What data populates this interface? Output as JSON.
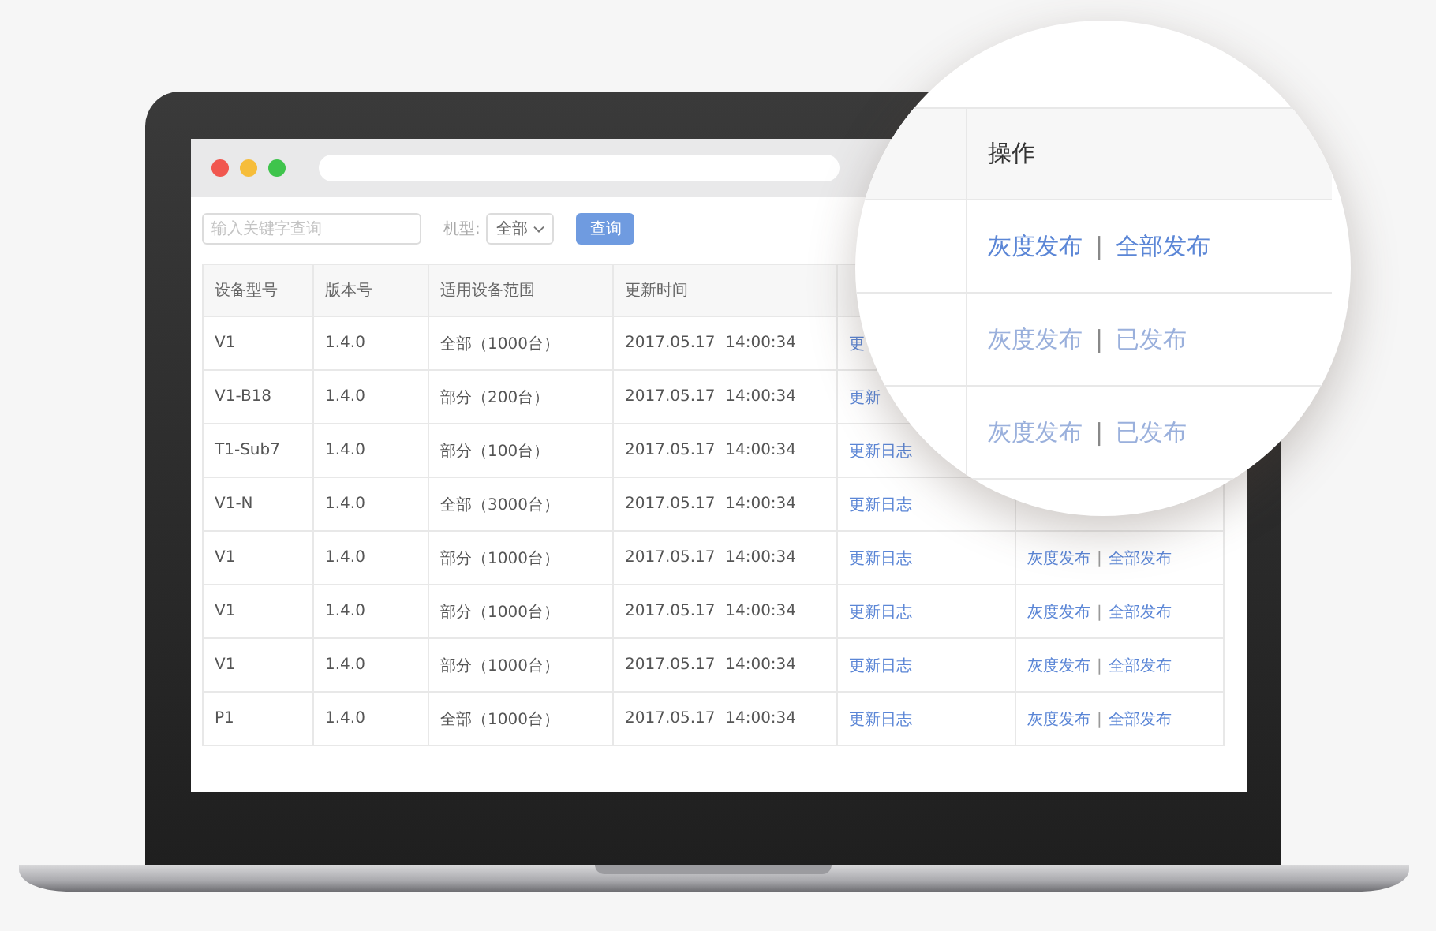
{
  "toolbar": {
    "search": {
      "placeholder": "输入关键字查询"
    },
    "model_filter": {
      "label": "机型:",
      "value": "全部"
    },
    "query_button": "查询"
  },
  "table": {
    "columns": [
      "设备型号",
      "版本号",
      "适用设备范围",
      "更新时间"
    ],
    "rows": [
      {
        "model": "V1",
        "version": "1.4.0",
        "scope": "全部（1000台）",
        "updated": "2017.05.17  14:00:34",
        "log": "更"
      },
      {
        "model": "V1-B18",
        "version": "1.4.0",
        "scope": "部分（200台）",
        "updated": "2017.05.17  14:00:34",
        "log": "更新"
      },
      {
        "model": "T1-Sub7",
        "version": "1.4.0",
        "scope": "部分（100台）",
        "updated": "2017.05.17  14:00:34",
        "log": "更新日志"
      },
      {
        "model": "V1-N",
        "version": "1.4.0",
        "scope": "全部（3000台）",
        "updated": "2017.05.17  14:00:34",
        "log": "更新日志"
      },
      {
        "model": "V1",
        "version": "1.4.0",
        "scope": "部分（1000台）",
        "updated": "2017.05.17  14:00:34",
        "log": "更新日志",
        "actions": {
          "primary": "灰度发布",
          "separator": "|",
          "secondary": "全部发布",
          "disabled": false
        }
      },
      {
        "model": "V1",
        "version": "1.4.0",
        "scope": "部分（1000台）",
        "updated": "2017.05.17  14:00:34",
        "log": "更新日志",
        "actions": {
          "primary": "灰度发布",
          "separator": "|",
          "secondary": "全部发布",
          "disabled": false
        }
      },
      {
        "model": "V1",
        "version": "1.4.0",
        "scope": "部分（1000台）",
        "updated": "2017.05.17  14:00:34",
        "log": "更新日志",
        "actions": {
          "primary": "灰度发布",
          "separator": "|",
          "secondary": "全部发布",
          "disabled": false
        }
      },
      {
        "model": "P1",
        "version": "1.4.0",
        "scope": "全部（1000台）",
        "updated": "2017.05.17  14:00:34",
        "log": "更新日志",
        "actions": {
          "primary": "灰度发布",
          "separator": "|",
          "secondary": "全部发布",
          "disabled": false
        }
      }
    ]
  },
  "magnifier": {
    "column": "操作",
    "rows": [
      {
        "primary": "灰度发布",
        "separator": "|",
        "secondary": "全部发布",
        "disabled": false
      },
      {
        "primary": "灰度发布",
        "separator": "|",
        "secondary": "已发布",
        "disabled": true
      },
      {
        "primary": "灰度发布",
        "separator": "|",
        "secondary": "已发布",
        "disabled": true
      }
    ]
  }
}
